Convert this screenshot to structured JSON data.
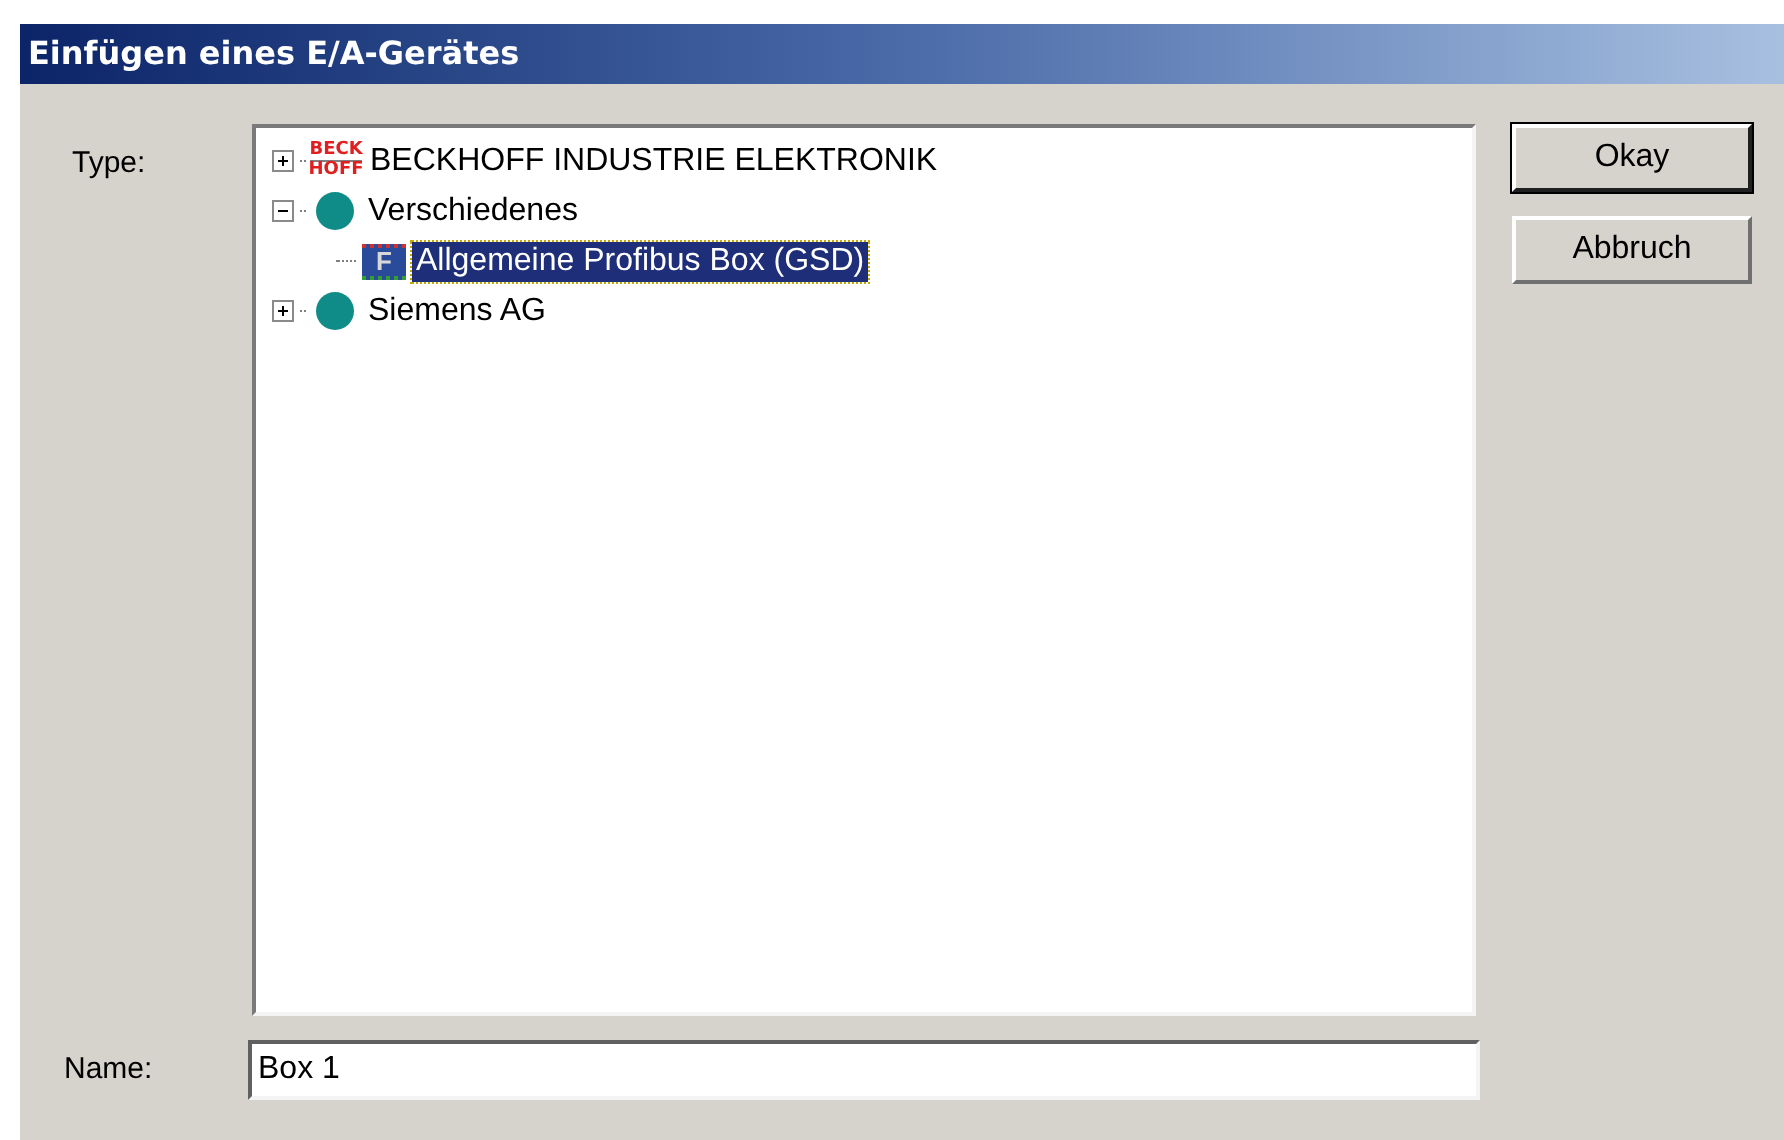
{
  "window": {
    "title": "Einfügen eines E/A-Gerätes"
  },
  "type_label": "Type:",
  "tree": [
    {
      "label": "BECKHOFF INDUSTRIE ELEKTRONIK",
      "kind": "logo",
      "logo_lines": [
        "BECK",
        "HOFF"
      ],
      "expanded": false,
      "selected": false
    },
    {
      "label": "Verschiedenes",
      "kind": "dot",
      "expanded": true,
      "selected": false,
      "children": [
        {
          "label": "Allgemeine Profibus Box (GSD)",
          "kind": "device",
          "icon_letter": "F",
          "selected": true
        }
      ]
    },
    {
      "label": "Siemens AG",
      "kind": "dot",
      "expanded": false,
      "selected": false
    }
  ],
  "buttons": [
    {
      "label": "Okay",
      "default": true
    },
    {
      "label": "Abbruch",
      "default": false
    }
  ],
  "name_label": "Name:",
  "name_field": {
    "value": "Box 1"
  }
}
